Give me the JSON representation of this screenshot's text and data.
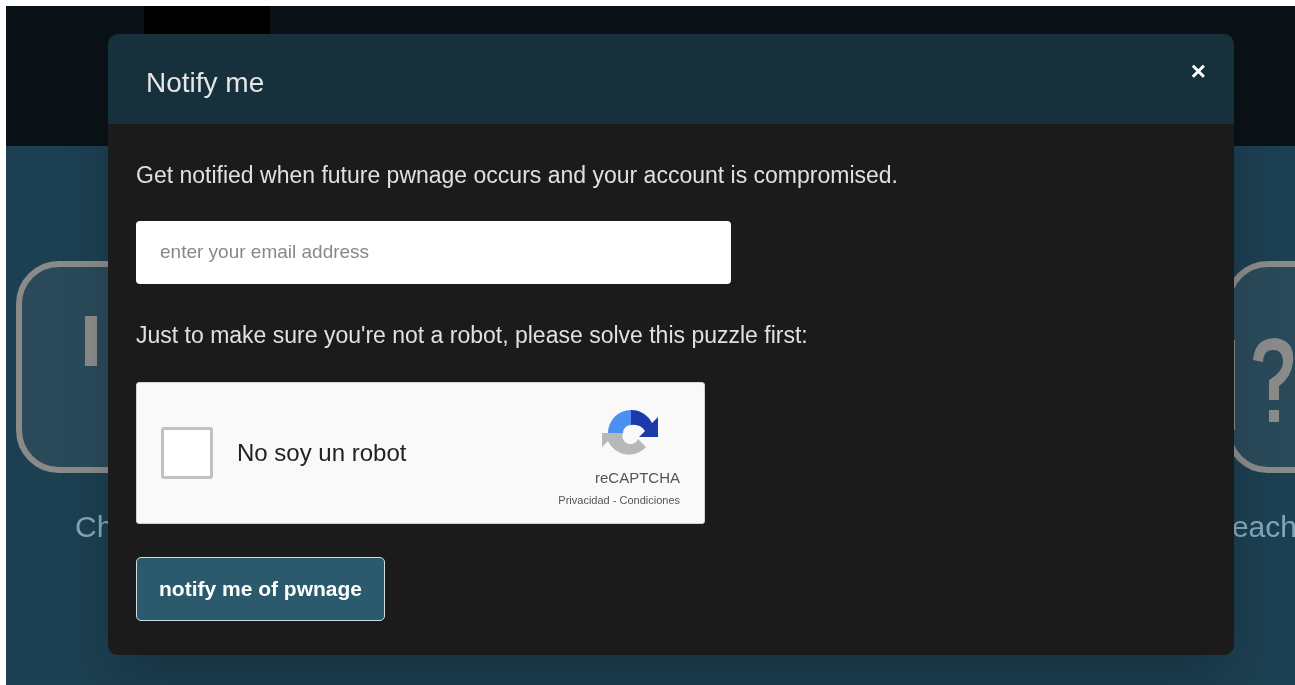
{
  "background": {
    "left_caption": "Ch",
    "right_caption": "each"
  },
  "modal": {
    "title": "Notify me",
    "close": "×",
    "intro": "Get notified when future pwnage occurs and your account is compromised.",
    "email": {
      "placeholder": "enter your email address"
    },
    "puzzle_prompt": "Just to make sure you're not a robot, please solve this puzzle first:",
    "captcha": {
      "label": "No soy un robot",
      "checked": false,
      "brand": "reCAPTCHA",
      "links": "Privacidad - Condiciones"
    },
    "submit": "notify me of pwnage"
  }
}
